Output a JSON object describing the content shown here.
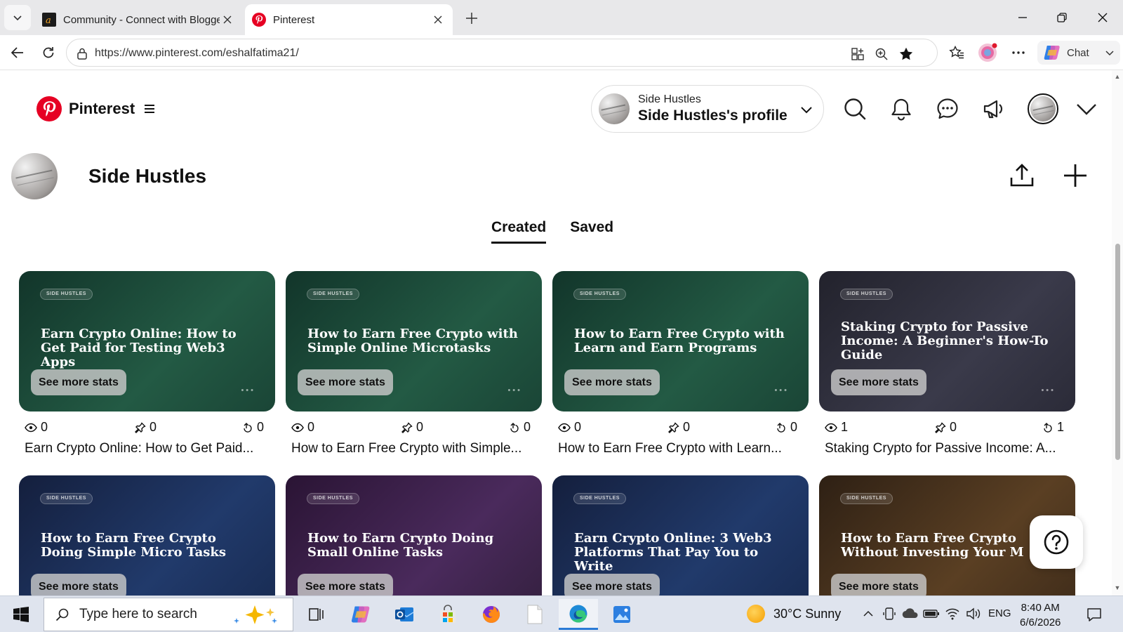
{
  "browser": {
    "tabs": [
      {
        "title": "Community - Connect with Blogge",
        "active": false
      },
      {
        "title": "Pinterest",
        "active": true
      }
    ],
    "url": "https://www.pinterest.com/eshalfatima21/",
    "chat_label": "Chat"
  },
  "header": {
    "brand": "Pinterest",
    "account_small": "Side Hustles",
    "account_big": "Side Hustles's profile"
  },
  "profile": {
    "name": "Side Hustles",
    "tabs": [
      "Created",
      "Saved"
    ]
  },
  "colors": {
    "pinterest_red": "#e60023"
  },
  "pins": [
    {
      "chip": "SIDE HUSTLES",
      "image_title": "Earn Crypto Online: How to Get Paid for Testing Web3 Apps",
      "stats_button": "See more stats",
      "views": "0",
      "saves": "0",
      "outbound": "0",
      "title": "Earn Crypto Online: How to Get Paid...",
      "bg": "#1f4d3a"
    },
    {
      "chip": "SIDE HUSTLES",
      "image_title": "How to Earn Free Crypto with Simple Online Microtasks",
      "stats_button": "See more stats",
      "views": "0",
      "saves": "0",
      "outbound": "0",
      "title": "How to Earn Free Crypto with Simple...",
      "bg": "#1f4d3a"
    },
    {
      "chip": "SIDE HUSTLES",
      "image_title": "How to Earn Free Crypto with Learn and Earn Programs",
      "stats_button": "See more stats",
      "views": "0",
      "saves": "0",
      "outbound": "0",
      "title": "How to Earn Free Crypto with Learn...",
      "bg": "#1f4d3a"
    },
    {
      "chip": "SIDE HUSTLES",
      "image_title": "Staking Crypto for Passive Income: A Beginner's How-To Guide",
      "stats_button": "See more stats",
      "views": "1",
      "saves": "0",
      "outbound": "1",
      "title": "Staking Crypto for Passive Income: A...",
      "bg": "#2f2f3d"
    },
    {
      "chip": "SIDE HUSTLES",
      "image_title": "How to Earn Free Crypto Doing Simple Micro Tasks",
      "stats_button": "See more stats",
      "bg": "#1c2f58"
    },
    {
      "chip": "SIDE HUSTLES",
      "image_title": "How to Earn Crypto Doing Small Online Tasks",
      "stats_button": "See more stats",
      "bg": "#3a2148"
    },
    {
      "chip": "SIDE HUSTLES",
      "image_title": "Earn Crypto Online: 3 Web3 Platforms That Pay You to Write",
      "stats_button": "See more stats",
      "bg": "#1c2f58"
    },
    {
      "chip": "SIDE HUSTLES",
      "image_title": "How to Earn Free Crypto Without Investing Your M",
      "stats_button": "See more stats",
      "bg": "#4a3420"
    }
  ],
  "taskbar": {
    "search_placeholder": "Type here to search",
    "weather": "30°C  Sunny",
    "lang": "ENG",
    "time": "8:40 AM",
    "date": "6/6/2026"
  }
}
